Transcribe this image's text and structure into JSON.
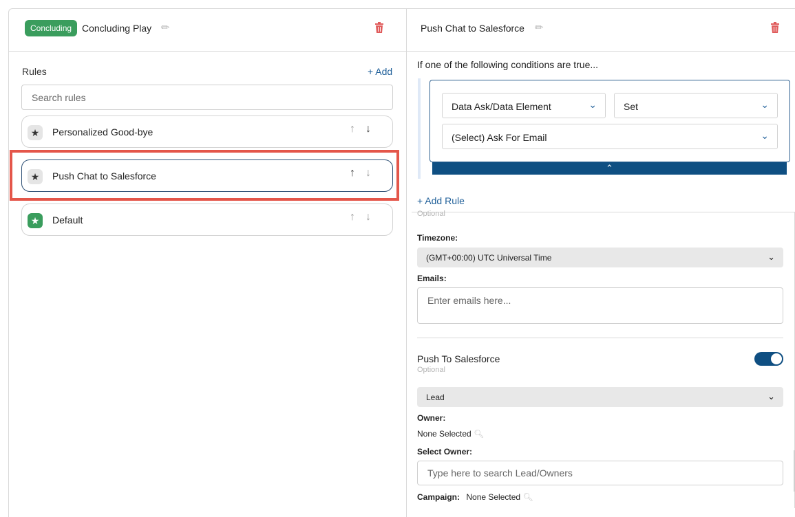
{
  "left": {
    "badge": "Concluding",
    "title": "Concluding Play",
    "rules_label": "Rules",
    "add_label": "+ Add",
    "search_placeholder": "Search rules",
    "rules": [
      {
        "label": "Personalized Good-bye"
      },
      {
        "label": "Push Chat to Salesforce"
      },
      {
        "label": "Default"
      }
    ]
  },
  "right": {
    "title": "Push Chat to Salesforce",
    "conditions_label": "If one of the following conditions are true...",
    "condition": {
      "field": "Data Ask/Data Element",
      "operator": "Set",
      "value": "(Select) Ask For Email"
    },
    "add_rule_label": "+ Add Rule",
    "optional_label": "Optional",
    "timezone_label": "Timezone:",
    "timezone_value": "(GMT+00:00) UTC Universal Time",
    "emails_label": "Emails:",
    "emails_placeholder": "Enter emails here...",
    "push_label": "Push To Salesforce",
    "push_optional": "Optional",
    "push_enabled": true,
    "object_value": "Lead",
    "owner_label": "Owner:",
    "owner_value": "None Selected",
    "select_owner_label": "Select Owner:",
    "owner_search_placeholder": "Type here to search Lead/Owners",
    "campaign_label": "Campaign:",
    "campaign_value": "None Selected"
  },
  "colors": {
    "badge_green": "#3a9d5d",
    "accent_blue": "#0f4f82",
    "link_blue": "#1f5f99",
    "delete_red": "#e05c5c",
    "highlight_red": "#e4564a"
  },
  "icons": {
    "edit": "pencil-icon",
    "delete": "trash-icon",
    "rule": "star-icon",
    "reorder_up": "arrow-up-icon",
    "reorder_down": "arrow-down-icon",
    "dropdown": "chevron-down-icon",
    "collapse": "chevron-up-icon",
    "lookup": "magnifier-icon"
  }
}
